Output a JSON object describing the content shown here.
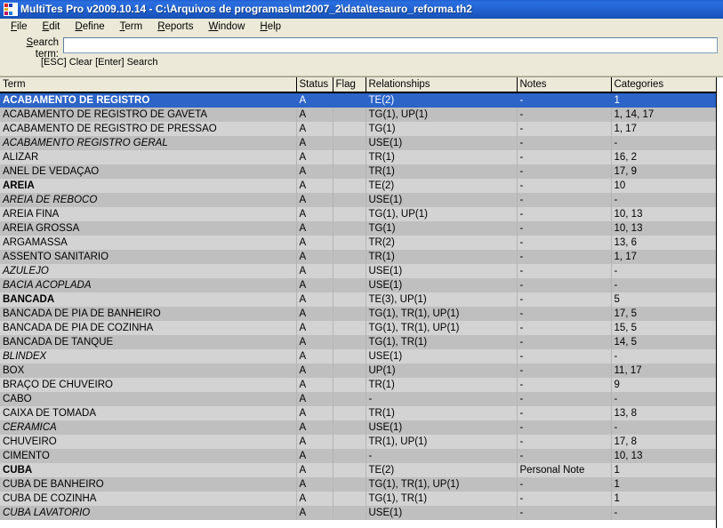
{
  "window": {
    "title": "MultiTes Pro v2009.10.14 - C:\\Arquivos de programas\\mt2007_2\\data\\tesauro_reforma.th2",
    "icon": "multites-app-icon"
  },
  "menu": [
    {
      "label": "File",
      "accel": "F"
    },
    {
      "label": "Edit",
      "accel": "E"
    },
    {
      "label": "Define",
      "accel": "D"
    },
    {
      "label": "Term",
      "accel": "T"
    },
    {
      "label": "Reports",
      "accel": "R"
    },
    {
      "label": "Window",
      "accel": "W"
    },
    {
      "label": "Help",
      "accel": "H"
    }
  ],
  "search": {
    "label_line1": "Search",
    "label_line2": "term:",
    "accel": "S",
    "value": "",
    "placeholder": "",
    "hint": "[ESC] Clear  [Enter] Search"
  },
  "grid": {
    "columns": [
      "Term",
      "Status",
      "Flag",
      "Relationships",
      "Notes",
      "Categories"
    ],
    "rows": [
      {
        "term": "ACABAMENTO DE REGISTRO",
        "style": "bold",
        "selected": true,
        "status": "A",
        "flag": "",
        "relationships": "TE(2)",
        "notes": "-",
        "categories": "1"
      },
      {
        "term": "ACABAMENTO DE REGISTRO DE GAVETA",
        "style": "normal",
        "selected": false,
        "status": "A",
        "flag": "",
        "relationships": "TG(1), UP(1)",
        "notes": "-",
        "categories": "1, 14, 17"
      },
      {
        "term": "ACABAMENTO DE REGISTRO DE PRESSAO",
        "style": "normal",
        "selected": false,
        "status": "A",
        "flag": "",
        "relationships": "TG(1)",
        "notes": "-",
        "categories": "1, 17"
      },
      {
        "term": "ACABAMENTO REGISTRO GERAL",
        "style": "italic",
        "selected": false,
        "status": "A",
        "flag": "",
        "relationships": "USE(1)",
        "notes": "-",
        "categories": "-"
      },
      {
        "term": "ALIZAR",
        "style": "normal",
        "selected": false,
        "status": "A",
        "flag": "",
        "relationships": "TR(1)",
        "notes": "-",
        "categories": "16, 2"
      },
      {
        "term": "ANEL DE VEDAÇAO",
        "style": "normal",
        "selected": false,
        "status": "A",
        "flag": "",
        "relationships": "TR(1)",
        "notes": "-",
        "categories": "17, 9"
      },
      {
        "term": "AREIA",
        "style": "bold",
        "selected": false,
        "status": "A",
        "flag": "",
        "relationships": "TE(2)",
        "notes": "-",
        "categories": "10"
      },
      {
        "term": "AREIA DE REBOCO",
        "style": "italic",
        "selected": false,
        "status": "A",
        "flag": "",
        "relationships": "USE(1)",
        "notes": "-",
        "categories": "-"
      },
      {
        "term": "AREIA FINA",
        "style": "normal",
        "selected": false,
        "status": "A",
        "flag": "",
        "relationships": "TG(1), UP(1)",
        "notes": "-",
        "categories": "10, 13"
      },
      {
        "term": "AREIA GROSSA",
        "style": "normal",
        "selected": false,
        "status": "A",
        "flag": "",
        "relationships": "TG(1)",
        "notes": "-",
        "categories": "10, 13"
      },
      {
        "term": "ARGAMASSA",
        "style": "normal",
        "selected": false,
        "status": "A",
        "flag": "",
        "relationships": "TR(2)",
        "notes": "-",
        "categories": "13, 6"
      },
      {
        "term": "ASSENTO SANITARIO",
        "style": "normal",
        "selected": false,
        "status": "A",
        "flag": "",
        "relationships": "TR(1)",
        "notes": "-",
        "categories": "1, 17"
      },
      {
        "term": "AZULEJO",
        "style": "italic",
        "selected": false,
        "status": "A",
        "flag": "",
        "relationships": "USE(1)",
        "notes": "-",
        "categories": "-"
      },
      {
        "term": "BACIA ACOPLADA",
        "style": "italic",
        "selected": false,
        "status": "A",
        "flag": "",
        "relationships": "USE(1)",
        "notes": "-",
        "categories": "-"
      },
      {
        "term": "BANCADA",
        "style": "bold",
        "selected": false,
        "status": "A",
        "flag": "",
        "relationships": "TE(3), UP(1)",
        "notes": "-",
        "categories": "5"
      },
      {
        "term": "BANCADA DE PIA DE BANHEIRO",
        "style": "normal",
        "selected": false,
        "status": "A",
        "flag": "",
        "relationships": "TG(1), TR(1), UP(1)",
        "notes": "-",
        "categories": "17, 5"
      },
      {
        "term": "BANCADA DE PIA DE COZINHA",
        "style": "normal",
        "selected": false,
        "status": "A",
        "flag": "",
        "relationships": "TG(1), TR(1), UP(1)",
        "notes": "-",
        "categories": "15, 5"
      },
      {
        "term": "BANCADA DE TANQUE",
        "style": "normal",
        "selected": false,
        "status": "A",
        "flag": "",
        "relationships": "TG(1), TR(1)",
        "notes": "-",
        "categories": "14, 5"
      },
      {
        "term": "BLINDEX",
        "style": "italic",
        "selected": false,
        "status": "A",
        "flag": "",
        "relationships": "USE(1)",
        "notes": "-",
        "categories": "-"
      },
      {
        "term": "BOX",
        "style": "normal",
        "selected": false,
        "status": "A",
        "flag": "",
        "relationships": "UP(1)",
        "notes": "-",
        "categories": "11, 17"
      },
      {
        "term": "BRAÇO DE CHUVEIRO",
        "style": "normal",
        "selected": false,
        "status": "A",
        "flag": "",
        "relationships": "TR(1)",
        "notes": "-",
        "categories": "9"
      },
      {
        "term": "CABO",
        "style": "normal",
        "selected": false,
        "status": "A",
        "flag": "",
        "relationships": "-",
        "notes": "-",
        "categories": "-"
      },
      {
        "term": "CAIXA DE TOMADA",
        "style": "normal",
        "selected": false,
        "status": "A",
        "flag": "",
        "relationships": "TR(1)",
        "notes": "-",
        "categories": "13, 8"
      },
      {
        "term": "CERAMICA",
        "style": "italic",
        "selected": false,
        "status": "A",
        "flag": "",
        "relationships": "USE(1)",
        "notes": "-",
        "categories": "-"
      },
      {
        "term": "CHUVEIRO",
        "style": "normal",
        "selected": false,
        "status": "A",
        "flag": "",
        "relationships": "TR(1), UP(1)",
        "notes": "-",
        "categories": "17, 8"
      },
      {
        "term": "CIMENTO",
        "style": "normal",
        "selected": false,
        "status": "A",
        "flag": "",
        "relationships": "-",
        "notes": "-",
        "categories": "10, 13"
      },
      {
        "term": "CUBA",
        "style": "bold",
        "selected": false,
        "status": "A",
        "flag": "",
        "relationships": "TE(2)",
        "notes": "Personal Note",
        "categories": "1"
      },
      {
        "term": "CUBA DE BANHEIRO",
        "style": "normal",
        "selected": false,
        "status": "A",
        "flag": "",
        "relationships": "TG(1), TR(1), UP(1)",
        "notes": "-",
        "categories": "1"
      },
      {
        "term": "CUBA DE COZINHA",
        "style": "normal",
        "selected": false,
        "status": "A",
        "flag": "",
        "relationships": "TG(1), TR(1)",
        "notes": "-",
        "categories": "1"
      },
      {
        "term": "CUBA LAVATORIO",
        "style": "italic",
        "selected": false,
        "status": "A",
        "flag": "",
        "relationships": "USE(1)",
        "notes": "-",
        "categories": "-"
      }
    ]
  },
  "colors": {
    "titlebar": "#1d5bc8",
    "selection": "#2c64c8",
    "row_odd": "#d3d3d3",
    "row_even": "#bfbfbf",
    "chrome": "#ece9d8"
  }
}
